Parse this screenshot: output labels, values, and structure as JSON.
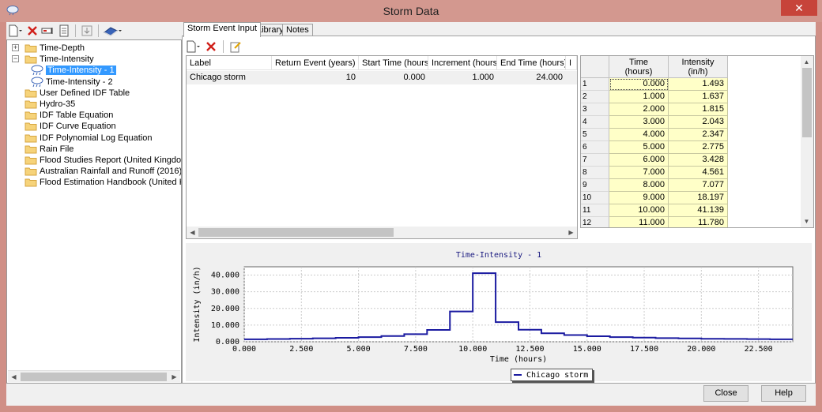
{
  "window": {
    "title": "Storm Data",
    "close_glyph": "✕"
  },
  "left_toolbar": {
    "icons": [
      "new-document-icon",
      "delete-icon",
      "rename-icon",
      "report-icon",
      "import-icon",
      "library-book-icon"
    ]
  },
  "tree": {
    "items": [
      {
        "label": "Time-Depth",
        "level": 0,
        "expander": "+",
        "icon": "folder-icon"
      },
      {
        "label": "Time-Intensity",
        "level": 0,
        "expander": "−",
        "icon": "folder-icon"
      },
      {
        "label": "Time-Intensity - 1",
        "level": 1,
        "icon": "rain-cloud-icon",
        "selected": true
      },
      {
        "label": "Time-Intensity - 2",
        "level": 1,
        "icon": "rain-cloud-icon"
      },
      {
        "label": "User Defined IDF Table",
        "level": 0,
        "icon": "folder-icon"
      },
      {
        "label": "Hydro-35",
        "level": 0,
        "icon": "folder-icon"
      },
      {
        "label": "IDF Table Equation",
        "level": 0,
        "icon": "folder-icon"
      },
      {
        "label": "IDF Curve Equation",
        "level": 0,
        "icon": "folder-icon"
      },
      {
        "label": "IDF Polynomial Log Equation",
        "level": 0,
        "icon": "folder-icon"
      },
      {
        "label": "Rain File",
        "level": 0,
        "icon": "folder-icon"
      },
      {
        "label": "Flood Studies Report (United Kingdom)",
        "level": 0,
        "icon": "folder-icon"
      },
      {
        "label": "Australian Rainfall and Runoff (2016)",
        "level": 0,
        "icon": "folder-icon"
      },
      {
        "label": "Flood Estimation Handbook (United Kingdo",
        "level": 0,
        "icon": "folder-icon"
      }
    ]
  },
  "tabs": [
    {
      "label": "Storm Event Input",
      "active": true
    },
    {
      "label": "Library",
      "active": false
    },
    {
      "label": "Notes",
      "active": false
    }
  ],
  "events_table": {
    "headers": [
      "Label",
      "Return Event (years)",
      "Start Time (hours)",
      "Increment (hours)",
      "End Time (hours)",
      "I"
    ],
    "rows": [
      [
        "Chicago storm",
        "10",
        "0.000",
        "1.000",
        "24.000",
        ""
      ]
    ]
  },
  "data_grid": {
    "headers": [
      [
        "Time",
        "(hours)"
      ],
      [
        "Intensity",
        "(in/h)"
      ]
    ],
    "rows": [
      [
        "1",
        "0.000",
        "1.493"
      ],
      [
        "2",
        "1.000",
        "1.637"
      ],
      [
        "3",
        "2.000",
        "1.815"
      ],
      [
        "4",
        "3.000",
        "2.043"
      ],
      [
        "5",
        "4.000",
        "2.347"
      ],
      [
        "6",
        "5.000",
        "2.775"
      ],
      [
        "7",
        "6.000",
        "3.428"
      ],
      [
        "8",
        "7.000",
        "4.561"
      ],
      [
        "9",
        "8.000",
        "7.077"
      ],
      [
        "10",
        "9.000",
        "18.197"
      ],
      [
        "11",
        "10.000",
        "41.139"
      ],
      [
        "12",
        "11.000",
        "11.780"
      ]
    ]
  },
  "chart_data": {
    "type": "line",
    "title": "Time-Intensity - 1",
    "xlabel": "Time (hours)",
    "ylabel": "Intensity (in/h)",
    "xlim": [
      0,
      24
    ],
    "ylim": [
      0,
      45
    ],
    "x_ticks": [
      "0.000",
      "2.500",
      "5.000",
      "7.500",
      "10.000",
      "12.500",
      "15.000",
      "17.500",
      "20.000",
      "22.500"
    ],
    "y_ticks": [
      "0.000",
      "10.000",
      "20.000",
      "30.000",
      "40.000"
    ],
    "grid": true,
    "legend_position": "bottom-center",
    "step": true,
    "series": [
      {
        "name": "Chicago storm",
        "color": "#1a1aa0",
        "x": [
          0,
          1,
          2,
          3,
          4,
          5,
          6,
          7,
          8,
          9,
          10,
          11,
          12,
          13,
          14,
          15,
          16,
          17,
          18,
          19,
          20,
          21,
          22,
          23
        ],
        "y": [
          1.493,
          1.637,
          1.815,
          2.043,
          2.347,
          2.775,
          3.428,
          4.561,
          7.077,
          18.197,
          41.139,
          11.78,
          7.2,
          5.1,
          4.0,
          3.3,
          2.8,
          2.5,
          2.2,
          2.0,
          1.8,
          1.7,
          1.6,
          1.5
        ]
      }
    ]
  },
  "buttons": {
    "close": "Close",
    "help": "Help"
  },
  "colors": {
    "accent": "#3399ff",
    "grid_cell": "#ffffc8",
    "series": "#1a1aa0",
    "window_frame": "#d08f86"
  }
}
